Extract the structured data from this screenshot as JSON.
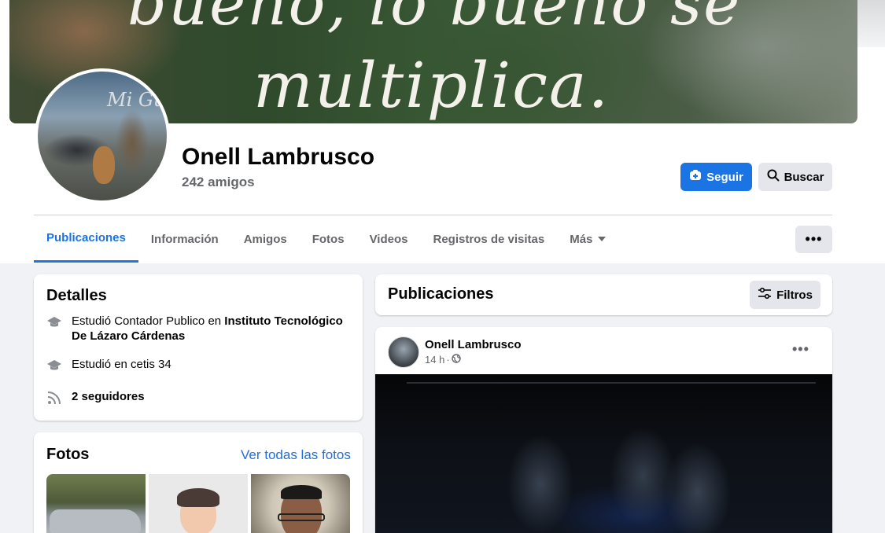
{
  "cover": {
    "line1": "bueno, lo bueno se",
    "line2": "multiplica."
  },
  "profile": {
    "name": "Onell Lambrusco",
    "friends": "242 amigos",
    "avatar_text": "Mi Guitarra y Yo"
  },
  "actions": {
    "follow": "Seguir",
    "search": "Buscar"
  },
  "tabs": [
    {
      "label": "Publicaciones",
      "active": true
    },
    {
      "label": "Información"
    },
    {
      "label": "Amigos"
    },
    {
      "label": "Fotos"
    },
    {
      "label": "Videos"
    },
    {
      "label": "Registros de visitas"
    },
    {
      "label": "Más"
    }
  ],
  "details": {
    "title": "Detalles",
    "study1_prefix": "Estudió Contador Publico en ",
    "study1_institution": "Instituto Tecnológico De Lázaro Cárdenas",
    "study2": "Estudió en cetis 34",
    "followers": "2 seguidores"
  },
  "photos": {
    "title": "Fotos",
    "see_all": "Ver todas las fotos"
  },
  "posts": {
    "title": "Publicaciones",
    "filters": "Filtros"
  },
  "post": {
    "author": "Onell Lambrusco",
    "time": "14 h",
    "separator": "·"
  },
  "colors": {
    "accent": "#1b74e4",
    "secondary_text": "#65676b",
    "page_bg": "#f0f2f5",
    "button_gray": "#e4e6eb"
  },
  "icons": {
    "follow": "user-plus-icon",
    "search": "search-icon",
    "more": "more-horizontal-icon",
    "filters": "filters-icon",
    "education": "graduation-cap-icon",
    "followers": "rss-feed-icon",
    "audience": "globe-icon"
  }
}
